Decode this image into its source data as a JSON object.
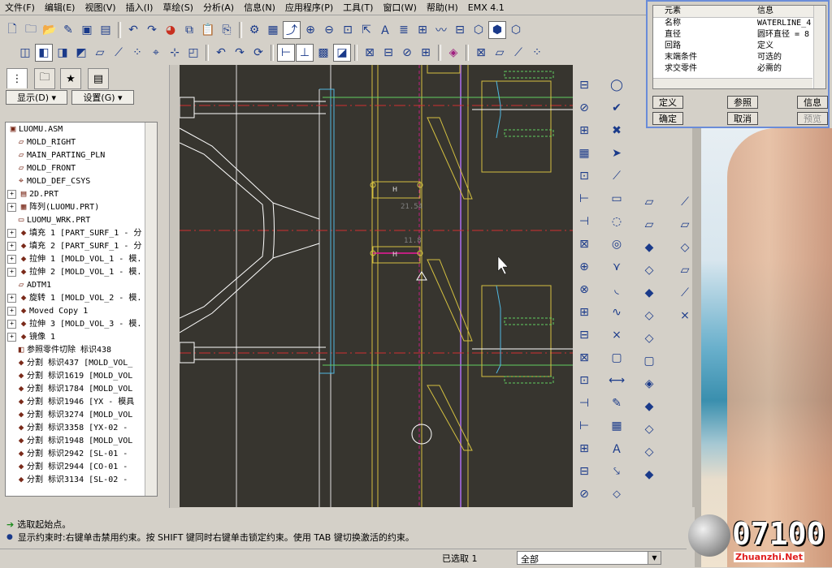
{
  "menu": {
    "items": [
      "文件(F)",
      "编辑(E)",
      "视图(V)",
      "插入(I)",
      "草绘(S)",
      "分析(A)",
      "信息(N)",
      "应用程序(P)",
      "工具(T)",
      "窗口(W)",
      "帮助(H)",
      "EMX 4.1"
    ]
  },
  "left_panel": {
    "show_dropdown": "显示(D) ▾",
    "settings_dropdown": "设置(G) ▾",
    "tree_items": [
      "LUOMU.ASM",
      "MOLD_RIGHT",
      "MAIN_PARTING_PLN",
      "MOLD_FRONT",
      "MOLD_DEF_CSYS",
      "2D.PRT",
      "阵列(LUOMU.PRT)",
      "LUOMU_WRK.PRT",
      "填充 1 [PART_SURF_1 - 分",
      "填充 2 [PART_SURF_1 - 分",
      "拉伸 1 [MOLD_VOL_1 - 模.",
      "拉伸 2 [MOLD_VOL_1 - 模.",
      "ADTM1",
      "旋转 1 [MOLD_VOL_2 - 模.",
      "Moved Copy 1",
      "拉伸 3 [MOLD_VOL_3 - 模.",
      "镜像 1",
      "参照零件切除 标识438",
      "分割 标识437 [MOLD_VOL_",
      "分割 标识1619 [MOLD_VOL",
      "分割 标识1784 [MOLD_VOL",
      "分割 标识1946 [YX - 模具",
      "分割 标识3274 [MOLD_VOL",
      "分割 标识3358 [YX-02 -",
      "分割 标识1948 [MOLD_VOL",
      "分割 标识2942 [SL-01 -",
      "分割 标识2944 [CO-01 -",
      "分割 标识3134 [SL-02 -"
    ]
  },
  "canvas": {
    "dim1": "21.54",
    "dim2": "11.8",
    "label_h": "H"
  },
  "dialog": {
    "col_element": "元素",
    "col_info": "信息",
    "rows": [
      {
        "element": "名称",
        "info": "WATERLINE_4"
      },
      {
        "element": "直径",
        "info": "圆环直径 = 8"
      },
      {
        "element": "回路",
        "info": "定义"
      },
      {
        "element": "末端条件",
        "info": "可选的"
      },
      {
        "element": "求交零件",
        "info": "必需的"
      }
    ],
    "btn_define": "定义",
    "btn_refs": "参照",
    "btn_info": "信息",
    "btn_ok": "确定",
    "btn_cancel": "取消",
    "btn_preview": "预览"
  },
  "messages": {
    "line1": "选取起始点。",
    "line2": "显示约束时:右键单击禁用约束。按 SHIFT 键同时右键单击锁定约束。使用 TAB 键切换激活的约束。"
  },
  "status": {
    "selected": "已选取 1",
    "filter_value": "全部"
  },
  "watermark": {
    "digits": "07100",
    "site": "Zhuanzhi.Net"
  },
  "colors": {
    "canvas_bg": "#37352f",
    "dialog_border": "#6a8cd8",
    "accent": "#1a3a8a"
  }
}
